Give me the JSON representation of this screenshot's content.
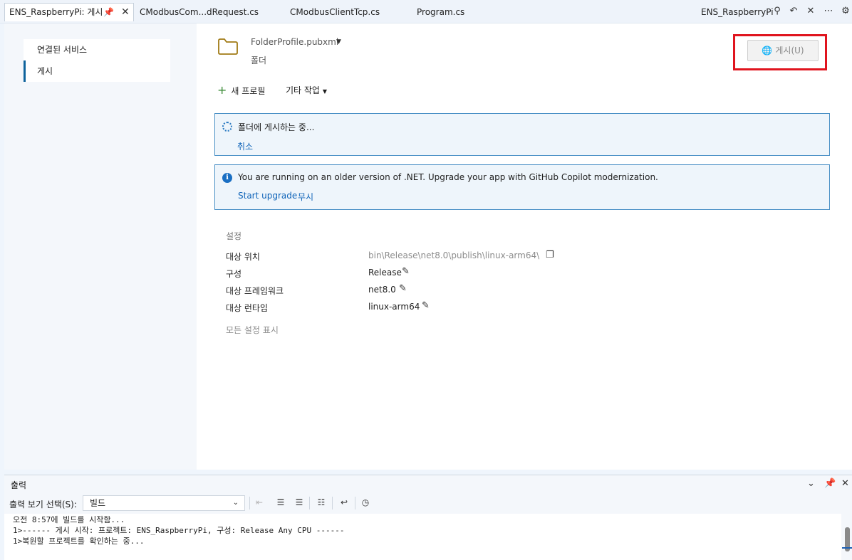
{
  "tabs": {
    "active_label": "ENS_RaspberryPi: 게시",
    "tab2": "CModbusCom...dRequest.cs",
    "tab3": "CModbusClientTcp.cs",
    "tab4": "Program.cs",
    "right_label": "ENS_RaspberryPi"
  },
  "left_nav": {
    "items": [
      {
        "label": "연결된 서비스"
      },
      {
        "label": "게시"
      }
    ]
  },
  "profile": {
    "name": "FolderProfile.pubxml",
    "type": "폴더",
    "publish_button": "게시(U)"
  },
  "actions": {
    "new_profile": "새 프로필",
    "more_actions": "기타 작업"
  },
  "progress": {
    "message": "폴더에 게시하는 중...",
    "cancel": "취소"
  },
  "upgrade_notice": {
    "message": "You are running on an older version of .NET. Upgrade your app with GitHub Copilot modernization.",
    "start_upgrade": "Start upgrade",
    "ignore": "무시"
  },
  "settings": {
    "title": "설정",
    "rows": [
      {
        "label": "대상 위치",
        "value": "bin\\Release\\net8.0\\publish\\linux-arm64\\"
      },
      {
        "label": "구성",
        "value": "Release"
      },
      {
        "label": "대상 프레임워크",
        "value": "net8.0"
      },
      {
        "label": "대상 런타임",
        "value": "linux-arm64"
      }
    ],
    "show_all": "모든 설정 표시"
  },
  "output": {
    "title": "출력",
    "source_label": "출력 보기 선택(S):",
    "source_value": "빌드",
    "text": "오전 8:57에 빌드를 시작함...\n1>------ 게시 시작: 프로젝트: ENS_RaspberryPi, 구성: Release Any CPU ------\n1>복원할 프로젝트를 확인하는 중..."
  },
  "colors": {
    "accent": "#0e639c",
    "highlight_box": "#e0141e",
    "info_border": "#4a90c6"
  }
}
